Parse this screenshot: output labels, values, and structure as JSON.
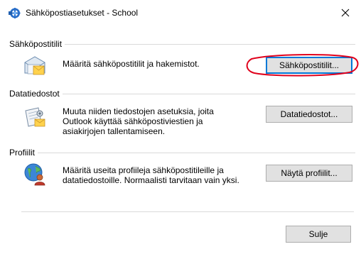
{
  "window": {
    "title": "Sähköpostiasetukset - School",
    "close_glyph": "✕"
  },
  "sections": [
    {
      "label": "Sähköpostitilit",
      "description": "Määritä sähköpostitilit ja hakemistot.",
      "button_label": "Sähköpostitilit...",
      "icon": "email-accounts-icon"
    },
    {
      "label": "Datatiedostot",
      "description": "Muuta niiden tiedostojen asetuksia, joita Outlook käyttää sähköpostiviestien ja asiakirjojen tallentamiseen.",
      "button_label": "Datatiedostot...",
      "icon": "data-files-icon"
    },
    {
      "label": "Profiilit",
      "description": "Määritä useita profiileja sähköpostitileille ja datatiedostoille. Normaalisti tarvitaan vain yksi.",
      "button_label": "Näytä profiilit...",
      "icon": "profiles-icon"
    }
  ],
  "footer": {
    "close_label": "Sulje"
  },
  "colors": {
    "annotation_ellipse": "#e0001b",
    "focus_border": "#0078d7",
    "button_face": "#e1e1e1"
  }
}
